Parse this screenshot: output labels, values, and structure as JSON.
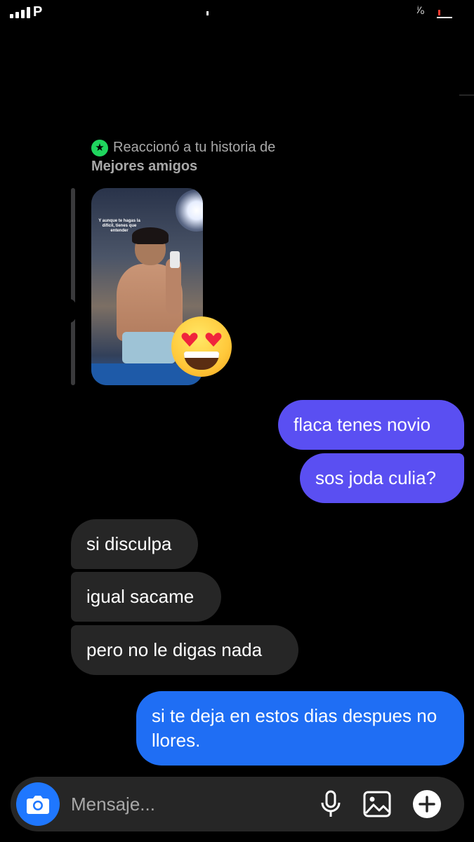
{
  "status_bar": {
    "carrier": "P",
    "battery_text": "ⁱ⁄ₒ"
  },
  "story_reaction": {
    "label": "Reaccionó a tu historia de",
    "audience": "Mejores amigos",
    "badge_icon": "star-icon",
    "story_caption": "Y aunque te hagas la difícil, tienes que entender",
    "reaction_emoji": "heart-eyes-emoji"
  },
  "messages": [
    {
      "direction": "sent",
      "text": "flaca tenes novio"
    },
    {
      "direction": "sent",
      "text": "sos joda culia?"
    },
    {
      "direction": "received",
      "text": "si disculpa"
    },
    {
      "direction": "received",
      "text": "igual sacame"
    },
    {
      "direction": "received",
      "text": "pero no le digas nada"
    },
    {
      "direction": "sent",
      "text": "si te deja en estos dias despues no llores."
    }
  ],
  "composer": {
    "placeholder": "Mensaje...",
    "icons": [
      "camera-icon",
      "microphone-icon",
      "gallery-icon",
      "plus-icon"
    ]
  },
  "colors": {
    "sent_bubble_purple": "#5a4ff2",
    "sent_bubble_blue": "#1f6ef4",
    "received_bubble": "#262626",
    "close_friends_green": "#1fd65e",
    "camera_button": "#1f77ff"
  }
}
